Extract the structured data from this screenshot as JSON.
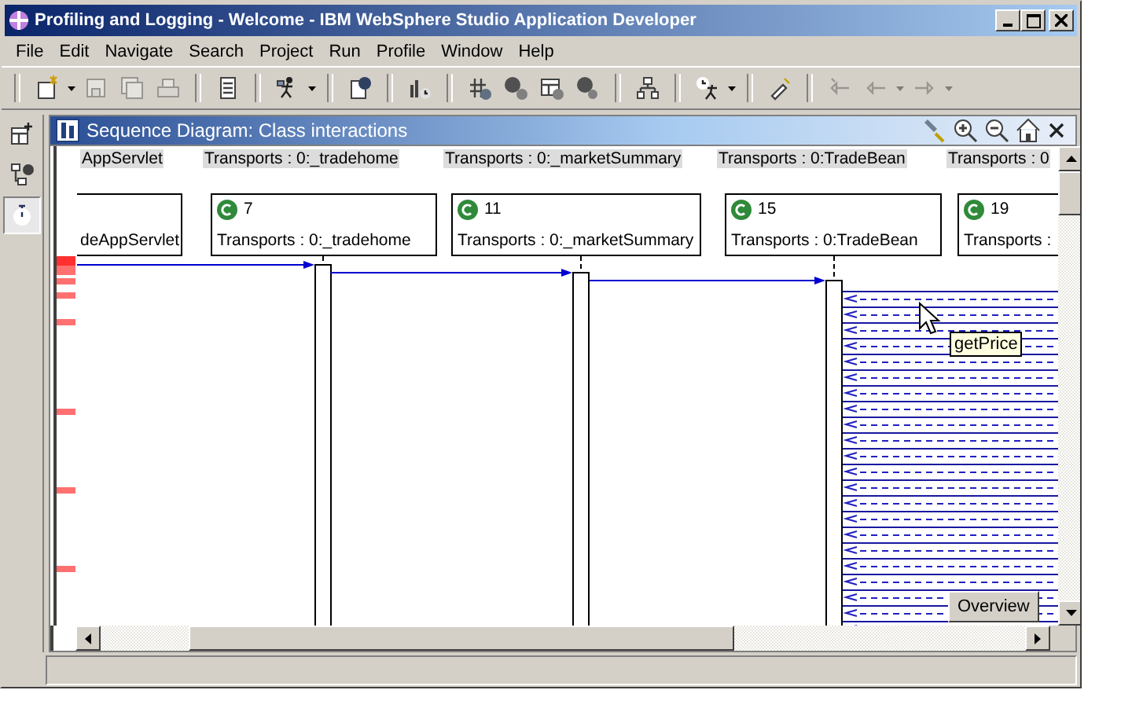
{
  "window": {
    "title": "Profiling and Logging - Welcome - IBM WebSphere Studio Application Developer"
  },
  "menu": [
    "File",
    "Edit",
    "Navigate",
    "Search",
    "Project",
    "Run",
    "Profile",
    "Window",
    "Help"
  ],
  "toolbar": [
    [
      {
        "kind": "newfile",
        "disabled": false,
        "dropdown": true
      },
      {
        "kind": "save",
        "disabled": true,
        "dropdown": false
      },
      {
        "kind": "saveall",
        "disabled": true,
        "dropdown": false
      },
      {
        "kind": "print",
        "disabled": true,
        "dropdown": false
      }
    ],
    [
      {
        "kind": "notes",
        "disabled": false,
        "dropdown": false
      }
    ],
    [
      {
        "kind": "runner",
        "disabled": false,
        "dropdown": true
      }
    ],
    [
      {
        "kind": "docglobe",
        "disabled": false,
        "dropdown": false
      }
    ],
    [
      {
        "kind": "chart",
        "disabled": false,
        "dropdown": false
      }
    ],
    [
      {
        "kind": "classgrid",
        "disabled": false,
        "dropdown": false
      },
      {
        "kind": "classm",
        "disabled": false,
        "dropdown": false
      },
      {
        "kind": "table",
        "disabled": false,
        "dropdown": false
      },
      {
        "kind": "classs",
        "disabled": false,
        "dropdown": false
      }
    ],
    [
      {
        "kind": "hierarchy",
        "disabled": false,
        "dropdown": false
      }
    ],
    [
      {
        "kind": "runclock",
        "disabled": false,
        "dropdown": true
      }
    ],
    [
      {
        "kind": "flashlight",
        "disabled": false,
        "dropdown": false
      }
    ],
    [
      {
        "kind": "history",
        "disabled": true,
        "dropdown": false
      },
      {
        "kind": "back",
        "disabled": true,
        "dropdown": true
      },
      {
        "kind": "forward",
        "disabled": true,
        "dropdown": true
      }
    ]
  ],
  "perspectives": [
    {
      "kind": "open",
      "selected": false
    },
    {
      "kind": "nodes",
      "selected": false
    },
    {
      "kind": "timer",
      "selected": true
    }
  ],
  "view": {
    "title": "Sequence Diagram: Class interactions"
  },
  "header_labels": [
    "AppServlet",
    "Transports : 0:_tradehome",
    "Transports : 0:_marketSummary",
    "Transports : 0:TradeBean",
    "Transports : 0"
  ],
  "lifelines": [
    {
      "name": "deAppServlet"
    },
    {
      "number": "7",
      "name": "Transports : 0:_tradehome"
    },
    {
      "number": "11",
      "name": "Transports : 0:_marketSummary"
    },
    {
      "number": "15",
      "name": "Transports : 0:TradeBean"
    },
    {
      "number": "19",
      "name": "Transports :"
    }
  ],
  "tooltip": "getPrice",
  "overview_button": "Overview"
}
